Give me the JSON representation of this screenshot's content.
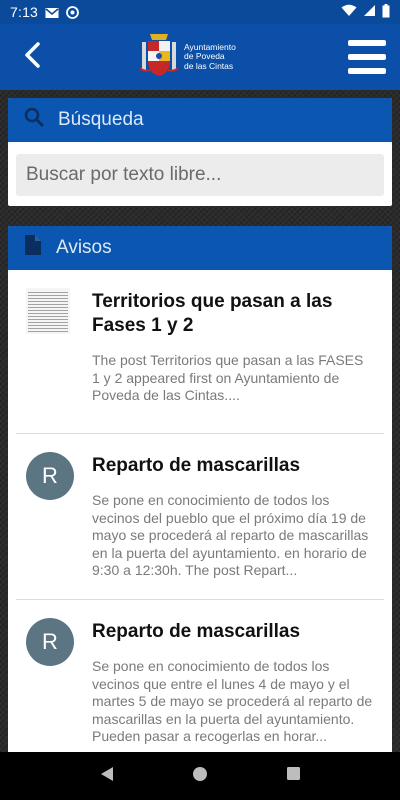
{
  "status_bar": {
    "time": "7:13",
    "icons_left": [
      "gmail-icon",
      "sync-icon"
    ],
    "icons_right": [
      "wifi-icon",
      "signal-icon",
      "battery-icon"
    ]
  },
  "app_bar": {
    "logo_lines": [
      "Ayuntamiento",
      "de Poveda",
      "de las Cintas"
    ],
    "icons": [
      "back-arrow-icon",
      "coat-of-arms-icon",
      "hamburger-menu-icon"
    ]
  },
  "search": {
    "header": "Búsqueda",
    "placeholder": "Buscar por texto libre...",
    "icon": "search-icon"
  },
  "avisos": {
    "header": "Avisos",
    "icon": "document-icon",
    "posts": [
      {
        "thumb": "document-thumbnail",
        "title": "Territorios que pasan a las Fases 1 y 2",
        "excerpt": "The post Territorios que pasan a las FASES 1 y 2 appeared first on Ayuntamiento de Poveda de las Cintas...."
      },
      {
        "avatar_letter": "R",
        "title": "Reparto de mascarillas",
        "excerpt": "Se pone en conocimiento de todos los vecinos del pueblo que el próximo día 19 de mayo se procederá al reparto de mascarillas en la puerta del ayuntamiento. en horario de 9:30 a 12:30h. The post Repart..."
      },
      {
        "avatar_letter": "R",
        "title": "Reparto de mascarillas",
        "excerpt": "Se pone en conocimiento de todos los vecinos que entre el lunes 4 de mayo y el martes 5 de mayo se procederá al reparto de mascarillas en la puerta del ayuntamiento. Pueden pasar a recogerlas en horar..."
      }
    ]
  },
  "nav_bar": {
    "icons": [
      "back-triangle-icon",
      "home-circle-icon",
      "recents-square-icon"
    ]
  },
  "colors": {
    "primary": "#0b4fa8",
    "header": "#0b56b0",
    "avatar": "#5b7583"
  }
}
